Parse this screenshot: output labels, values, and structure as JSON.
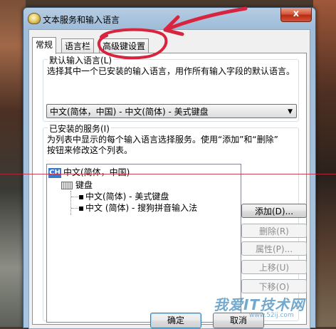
{
  "window": {
    "title": "文本服务和输入语言",
    "close_glyph": "x"
  },
  "tabs": [
    {
      "label": "常规",
      "active": true
    },
    {
      "label": "语言栏",
      "active": false
    },
    {
      "label": "高级键设置",
      "active": false
    }
  ],
  "default_language": {
    "group_title": "默认输入语言(L)",
    "description": "选择其中一个已安装的输入语言，用作所有输入字段的默认语言。",
    "selected": "中文(简体，中国) - 中文(简体) - 美式键盘"
  },
  "installed_services": {
    "group_title": "已安装的服务(I)",
    "description_line1": "为列表中显示的每个输入语言选择服务。使用“添加”和“删除”",
    "description_line2": "按钮来修改这个列表。",
    "tree": {
      "language_badge": "CH",
      "language": "中文(简体，中国)",
      "category": "键盘",
      "items": [
        "中文(简体) - 美式键盘",
        "中文 (简体) - 搜狗拼音输入法"
      ]
    },
    "buttons": {
      "add": "添加(D)...",
      "remove": "删除(R)",
      "properties": "属性(P)...",
      "move_up": "上移(U)",
      "move_down": "下移(O)"
    }
  },
  "footer": {
    "ok": "确定",
    "cancel": "取消"
  },
  "watermark": {
    "text": "我爱IT技术网",
    "url": "www.52ij.com"
  },
  "colors": {
    "annotation_red": "#d8253f",
    "selection_blue": "#3b78c8"
  }
}
